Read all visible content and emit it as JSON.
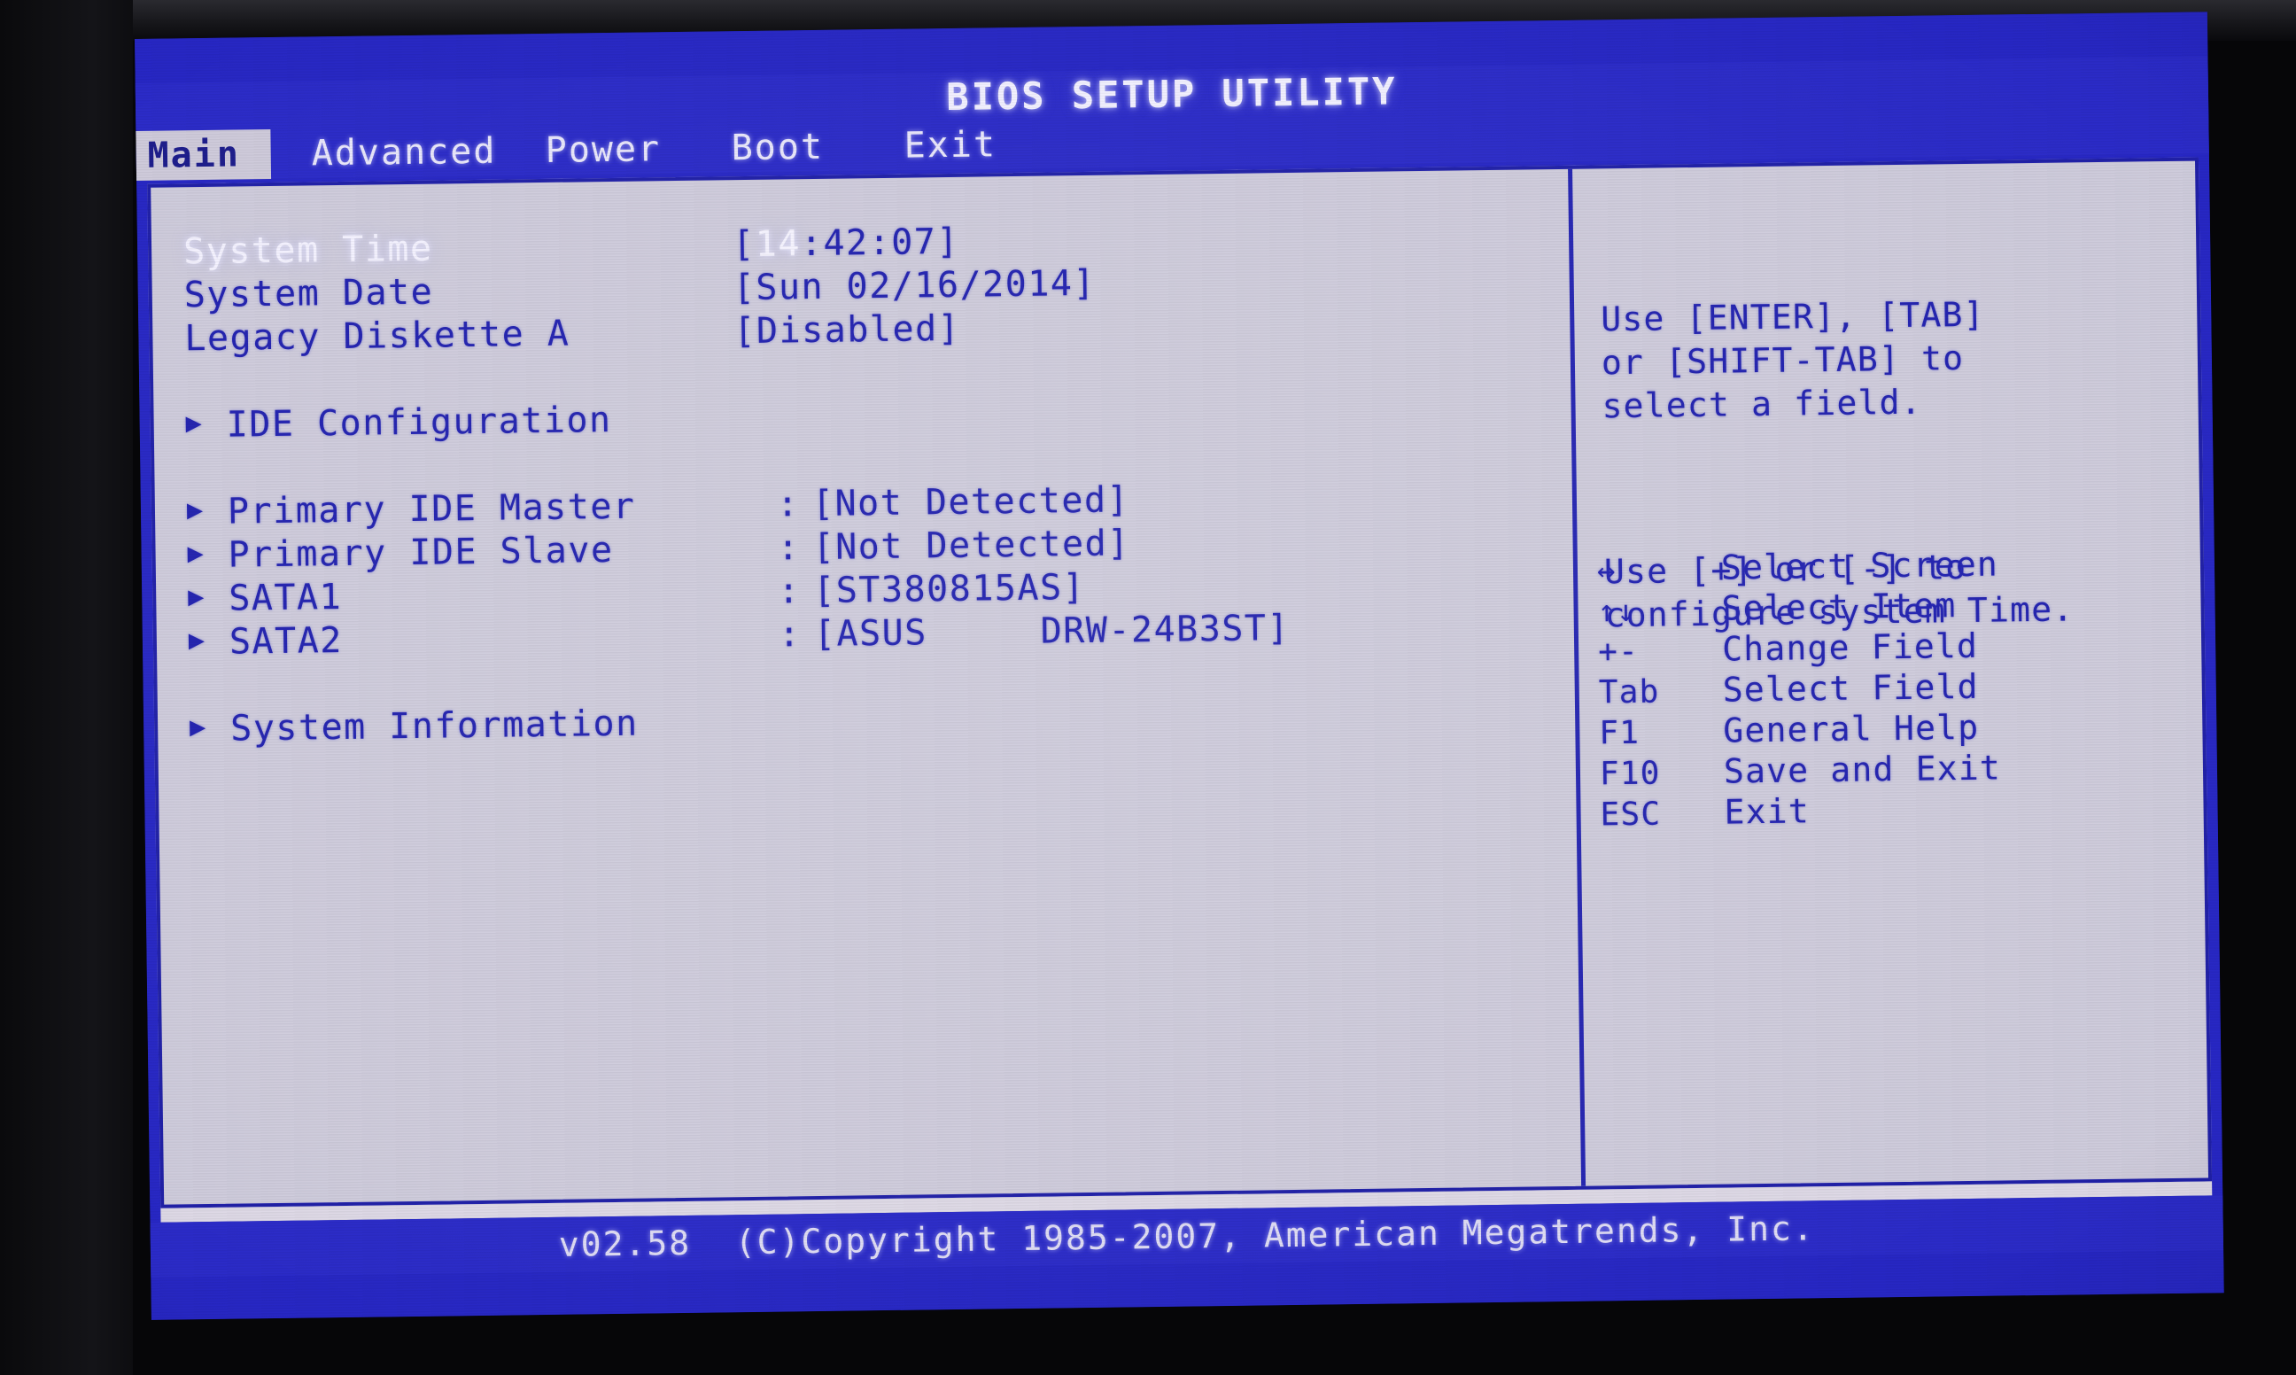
{
  "window": {
    "title": "BIOS SETUP UTILITY"
  },
  "colors": {
    "screen_blue": "#2b2bc8",
    "panel_bg": "#cfccdc",
    "text_blue": "#2222b0",
    "highlight_white": "#f4f2ff",
    "border_blue": "#2020a8"
  },
  "tabs": [
    {
      "label": "Main",
      "selected": true
    },
    {
      "label": "Advanced",
      "selected": false
    },
    {
      "label": "Power",
      "selected": false
    },
    {
      "label": "Boot",
      "selected": false
    },
    {
      "label": "Exit",
      "selected": false
    }
  ],
  "main": {
    "settings": [
      {
        "label": "System Time",
        "value_prefix": "[",
        "value_cursor": "14",
        "value_rest": ":42:07]",
        "selected": true
      },
      {
        "label": "System Date",
        "value": "[Sun 02/16/2014]",
        "selected": false
      },
      {
        "label": "Legacy Diskette A",
        "value": "[Disabled]",
        "selected": false
      }
    ],
    "submenus_top": [
      {
        "arrow": "▶",
        "label": "IDE Configuration"
      }
    ],
    "drives": [
      {
        "arrow": "▶",
        "label": "Primary IDE Master",
        "colon": ":",
        "value": "[Not Detected]"
      },
      {
        "arrow": "▶",
        "label": "Primary IDE Slave",
        "colon": ":",
        "value": "[Not Detected]"
      },
      {
        "arrow": "▶",
        "label": "SATA1",
        "colon": ":",
        "value": "[ST380815AS]"
      },
      {
        "arrow": "▶",
        "label": "SATA2",
        "colon": ":",
        "value": "[ASUS     DRW-24B3ST]"
      }
    ],
    "submenus_bottom": [
      {
        "arrow": "▶",
        "label": "System Information"
      }
    ]
  },
  "help": {
    "paragraph1": "Use [ENTER], [TAB]\nor [SHIFT-TAB] to\nselect a field.",
    "paragraph2": "Use [+] or [-] to\nconfigure system Time."
  },
  "keys": [
    {
      "key": "↔",
      "desc": "Select Screen"
    },
    {
      "key": "↑↓",
      "desc": "Select Item"
    },
    {
      "key": "+-",
      "desc": "Change Field"
    },
    {
      "key": "Tab",
      "desc": "Select Field"
    },
    {
      "key": "F1",
      "desc": "General Help"
    },
    {
      "key": "F10",
      "desc": "Save and Exit"
    },
    {
      "key": "ESC",
      "desc": "Exit"
    }
  ],
  "footer": {
    "text": "v02.58  (C)Copyright 1985-2007, American Megatrends, Inc."
  }
}
